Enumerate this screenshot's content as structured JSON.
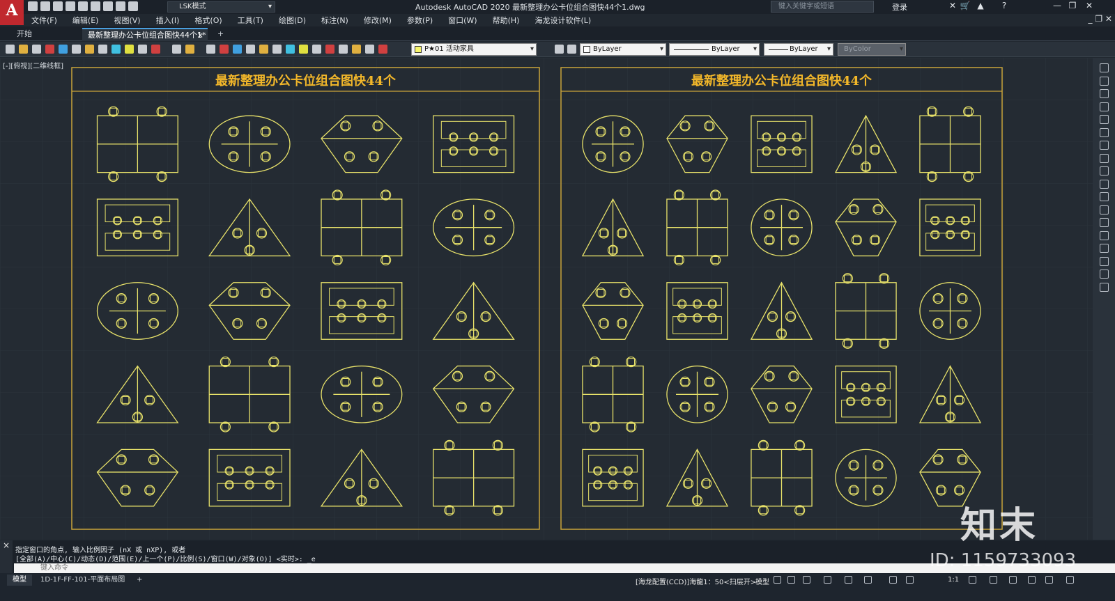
{
  "titlebar": {
    "logo": "A",
    "workspace": "LSK模式",
    "title": "Autodesk AutoCAD 2020    最新整理办公卡位组合图快44个1.dwg",
    "search_placeholder": "键入关键字或短语",
    "login": "登录"
  },
  "menu": {
    "items": [
      "文件(F)",
      "编辑(E)",
      "视图(V)",
      "插入(I)",
      "格式(O)",
      "工具(T)",
      "绘图(D)",
      "标注(N)",
      "修改(M)",
      "参数(P)",
      "窗口(W)",
      "帮助(H)",
      "海龙设计软件(L)"
    ]
  },
  "tabs": {
    "start": "开始",
    "doc": "最新整理办公卡位组合图快44个1*",
    "close": "×",
    "new": "+"
  },
  "toolbar": {
    "layer": "P★01 活动家具",
    "color": "ByLayer",
    "linetype": "ByLayer",
    "lineweight": "ByLayer",
    "plotstyle": "ByColor"
  },
  "viewport": {
    "label": "[-][俯视][二维线框]"
  },
  "panels": [
    {
      "title": "最新整理办公卡位组合图快44个"
    },
    {
      "title": "最新整理办公卡位组合图快44个"
    }
  ],
  "command": {
    "history1": "指定窗口的角点, 输入比例因子 (nX 或 nXP), 或者",
    "history2": "[全部(A)/中心(C)/动态(D)/范围(E)/上一个(P)/比例(S)/窗口(W)/对象(O)] <实时>: _e",
    "placeholder": "键入命令",
    "side_close": "×"
  },
  "status": {
    "model_tab": "模型",
    "layout_tab": "1D-1F-FF-101-平面布局图",
    "add": "+",
    "info": "[海龙配置(CCD)]海龍1：50<扫层开>",
    "space": "模型",
    "scale": "1:1"
  },
  "watermark": {
    "brand": "知末",
    "id": "ID: 1159733093"
  },
  "colors": {
    "drawing_line": "#e8e26a",
    "title_text": "#f2b72a",
    "frame": "#c9a43a",
    "background": "#242b33"
  }
}
